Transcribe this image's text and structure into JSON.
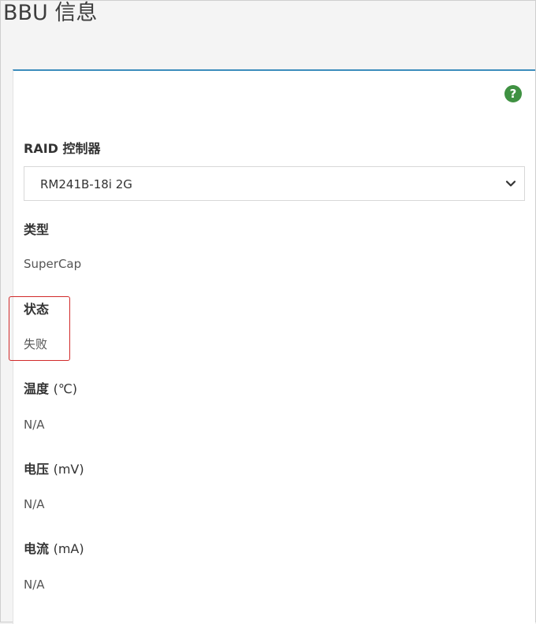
{
  "page": {
    "title": "BBU 信息"
  },
  "help_icon": {
    "glyph": "?",
    "color": "#3f9142"
  },
  "raid": {
    "label": "RAID 控制器",
    "selected": "RM241B-18i 2G"
  },
  "fields": {
    "type": {
      "label": "类型",
      "value": "SuperCap"
    },
    "status": {
      "label": "状态",
      "value": "失败"
    },
    "temperature": {
      "label": "温度",
      "unit": "(℃)",
      "value": "N/A"
    },
    "voltage": {
      "label": "电压",
      "unit": "(mV)",
      "value": "N/A"
    },
    "current": {
      "label": "电流",
      "unit": "(mA)",
      "value": "N/A"
    }
  },
  "colors": {
    "accent": "#3c8dbc",
    "highlight": "#d12a2a"
  }
}
